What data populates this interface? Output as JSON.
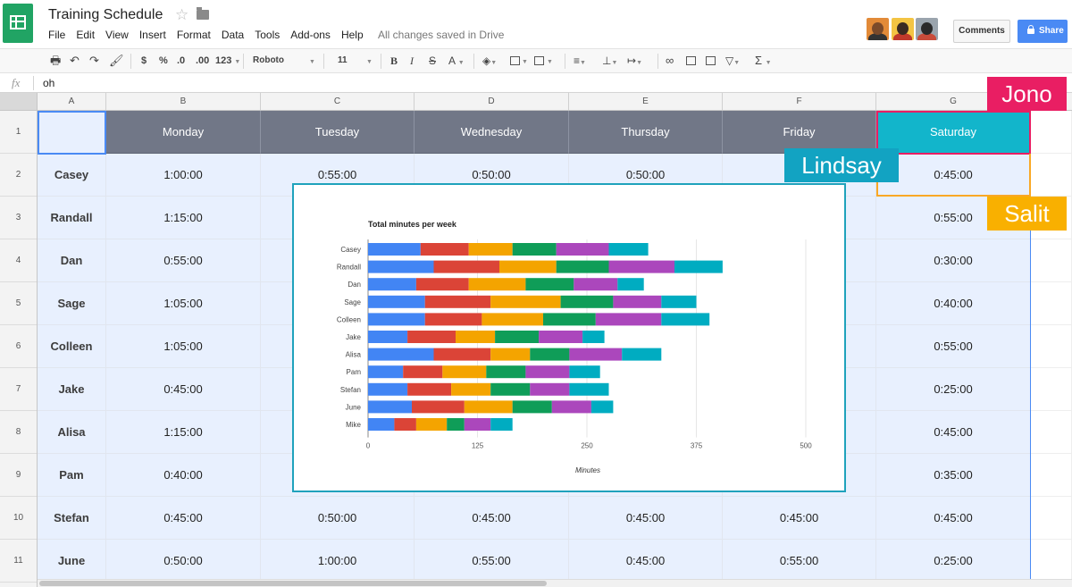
{
  "app": {
    "title": "Training Schedule",
    "save_status": "All changes saved in Drive",
    "star_icon": "star-outline-icon",
    "folder_icon": "folder-icon"
  },
  "menu": [
    "File",
    "Edit",
    "View",
    "Insert",
    "Format",
    "Data",
    "Tools",
    "Add-ons",
    "Help"
  ],
  "header_buttons": {
    "comments": "Comments",
    "share": "Share"
  },
  "toolbar": {
    "currency": "$",
    "percent": "%",
    "decrease_decimals": ".0",
    "increase_decimals": ".00",
    "more_formats": "123",
    "font_name": "Roboto",
    "font_size": "11",
    "bold": "B",
    "italic": "I",
    "strikethrough": "S",
    "text_color": "A",
    "functions": "Σ"
  },
  "formula_bar": {
    "label": "fx",
    "value": "oh"
  },
  "columns": [
    "A",
    "B",
    "C",
    "D",
    "E",
    "F",
    "G"
  ],
  "rows": [
    "1",
    "2",
    "3",
    "4",
    "5",
    "6",
    "7",
    "8",
    "9",
    "10",
    "11"
  ],
  "headers": [
    "",
    "Monday",
    "Tuesday",
    "Wednesday",
    "Thursday",
    "Friday",
    "Saturday"
  ],
  "schedule": [
    {
      "name": "Casey",
      "b": "1:00:00",
      "c": "0:55:00",
      "d": "0:50:00",
      "e": "0:50:00",
      "f": "",
      "g": "0:45:00"
    },
    {
      "name": "Randall",
      "b": "1:15:00",
      "c": "",
      "d": "",
      "e": "",
      "f": "",
      "g": "0:55:00"
    },
    {
      "name": "Dan",
      "b": "0:55:00",
      "c": "",
      "d": "",
      "e": "",
      "f": "",
      "g": "0:30:00"
    },
    {
      "name": "Sage",
      "b": "1:05:00",
      "c": "",
      "d": "",
      "e": "",
      "f": "",
      "g": "0:40:00"
    },
    {
      "name": "Colleen",
      "b": "1:05:00",
      "c": "",
      "d": "",
      "e": "",
      "f": "",
      "g": "0:55:00"
    },
    {
      "name": "Jake",
      "b": "0:45:00",
      "c": "",
      "d": "",
      "e": "",
      "f": "",
      "g": "0:25:00"
    },
    {
      "name": "Alisa",
      "b": "1:15:00",
      "c": "",
      "d": "",
      "e": "",
      "f": "",
      "g": "0:45:00"
    },
    {
      "name": "Pam",
      "b": "0:40:00",
      "c": "",
      "d": "",
      "e": "",
      "f": "",
      "g": "0:35:00"
    },
    {
      "name": "Stefan",
      "b": "0:45:00",
      "c": "0:50:00",
      "d": "0:45:00",
      "e": "0:45:00",
      "f": "0:45:00",
      "g": "0:45:00"
    },
    {
      "name": "June",
      "b": "0:50:00",
      "c": "1:00:00",
      "d": "0:55:00",
      "e": "0:45:00",
      "f": "0:55:00",
      "g": "0:25:00"
    }
  ],
  "collaborators": [
    {
      "name": "Jono",
      "color": "#e91e63"
    },
    {
      "name": "Lindsay",
      "color": "#12a3c2"
    },
    {
      "name": "Salit",
      "color": "#f9b000"
    }
  ],
  "colors": {
    "sheets_green": "#21a464",
    "header_gray": "#717787",
    "selection_blue": "#4a8af4",
    "row_fill": "#e8f0fe",
    "saturday_header": "#12b5cb"
  },
  "chart_data": {
    "type": "bar",
    "orientation": "horizontal",
    "stacked": true,
    "title": "Total minutes per week",
    "xlabel": "Minutes",
    "ylabel": "",
    "xlim": [
      0,
      500
    ],
    "xticks": [
      0,
      125,
      250,
      375,
      500
    ],
    "grid": true,
    "categories": [
      "Casey",
      "Randall",
      "Dan",
      "Sage",
      "Colleen",
      "Jake",
      "Alisa",
      "Pam",
      "Stefan",
      "June",
      "Mike"
    ],
    "series": [
      {
        "color": "#4285f4",
        "values": [
          60,
          75,
          55,
          65,
          65,
          45,
          75,
          40,
          45,
          50,
          30
        ]
      },
      {
        "color": "#db4437",
        "values": [
          55,
          75,
          60,
          75,
          65,
          55,
          65,
          45,
          50,
          60,
          25
        ]
      },
      {
        "color": "#f4a400",
        "values": [
          50,
          65,
          65,
          80,
          70,
          45,
          45,
          50,
          45,
          55,
          35
        ]
      },
      {
        "color": "#0f9d58",
        "values": [
          50,
          60,
          55,
          60,
          60,
          50,
          45,
          45,
          45,
          45,
          20
        ]
      },
      {
        "color": "#ab47bc",
        "values": [
          60,
          75,
          50,
          55,
          75,
          50,
          60,
          50,
          45,
          45,
          30
        ]
      },
      {
        "color": "#00acc1",
        "values": [
          45,
          55,
          30,
          40,
          55,
          25,
          45,
          35,
          45,
          25,
          25
        ]
      }
    ]
  }
}
